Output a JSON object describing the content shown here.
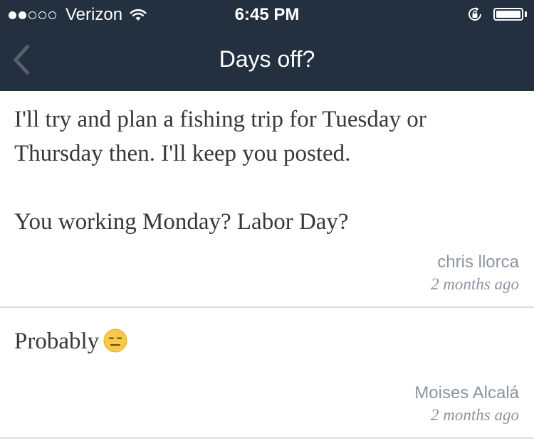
{
  "status_bar": {
    "signal_strength": 2,
    "signal_total": 5,
    "carrier": "Verizon",
    "time": "6:45 PM",
    "battery_level": 1.0,
    "icons": [
      "wifi-icon",
      "rotation-lock-icon",
      "battery-icon"
    ]
  },
  "nav": {
    "title": "Days off?",
    "back_icon": "chevron-left-icon"
  },
  "posts": [
    {
      "body": "I'll try and plan a fishing trip for Tuesday or\nThursday then. I'll keep you posted.\n\nYou working Monday? Labor Day?",
      "author": "chris llorca",
      "time": "2 months ago"
    },
    {
      "body": "Probably",
      "emoji": "expressionless-face-icon",
      "author": "Moises Alcalá",
      "time": "2 months ago"
    }
  ],
  "colors": {
    "header_bg": "#22303f",
    "body_text": "#383838",
    "meta_text": "#8b94a0",
    "divider": "#dcdcdc",
    "emoji_yellow": "#f7c948"
  }
}
